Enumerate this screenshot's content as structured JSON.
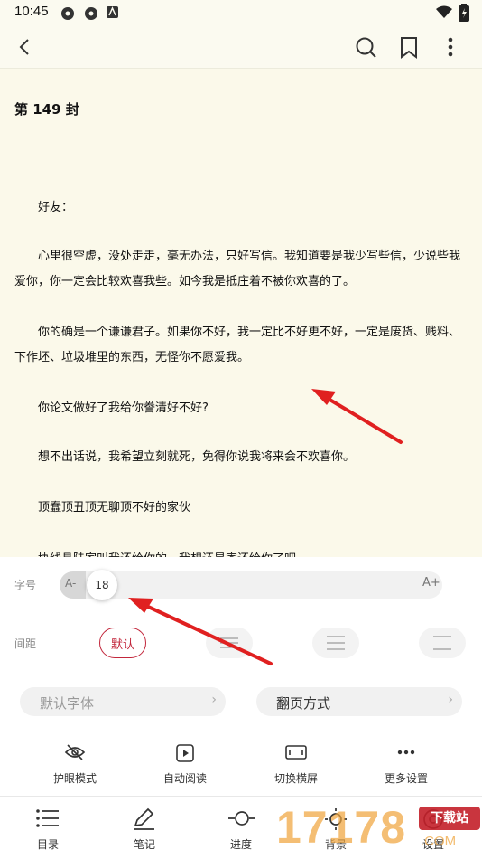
{
  "status_bar": {
    "time": "10:45"
  },
  "reader": {
    "chapter_title": "第 149 封",
    "paragraphs": [
      "好友：",
      "心里很空虚，没处走走，毫无办法，只好写信。我知道要是我少写些信，少说些我爱你，你一定会比较欢喜我些。如今我是抵庄着不被你欢喜的了。",
      "你的确是一个谦谦君子。如果你不好，我一定比不好更不好，一定是废货、贱料、下作坯、垃圾堆里的东西，无怪你不愿爱我。",
      "你论文做好了我给你誊清好不好?",
      "想不出话说，我希望立刻就死，免得你说我将来会不欢喜你。",
      "顶蠢顶丑顶无聊顶不好的家伙"
    ],
    "cut_off_line": "协线具陆家叫我还给你的，我想还是寄还给你了吧"
  },
  "settings": {
    "font_size_label": "字号",
    "font_size_value": "18",
    "font_size_fraction": 0.15,
    "decrease_label": "A-",
    "increase_label": "A+",
    "spacing_label": "间距",
    "spacing_default": "默认",
    "font_button": "默认字体",
    "page_turn_button": "翻页方式",
    "tools": [
      {
        "label": "护眼模式",
        "icon": "eye-off-icon"
      },
      {
        "label": "自动阅读",
        "icon": "play-icon"
      },
      {
        "label": "切换横屏",
        "icon": "landscape-icon"
      },
      {
        "label": "更多设置",
        "icon": "more-horizontal-icon"
      }
    ]
  },
  "bottom_nav": [
    {
      "label": "目录",
      "icon": "list-icon"
    },
    {
      "label": "笔记",
      "icon": "pen-icon"
    },
    {
      "label": "进度",
      "icon": "progress-icon"
    },
    {
      "label": "背景",
      "icon": "brightness-icon"
    },
    {
      "label": "设置",
      "icon": "settings-icon"
    }
  ],
  "watermark": {
    "digits": "17178",
    "badge": "下载站",
    "domain": ".COM"
  },
  "colors": {
    "reader_bg": "#fbf9ea",
    "accent": "#c2263b",
    "arrow": "#e02020"
  }
}
